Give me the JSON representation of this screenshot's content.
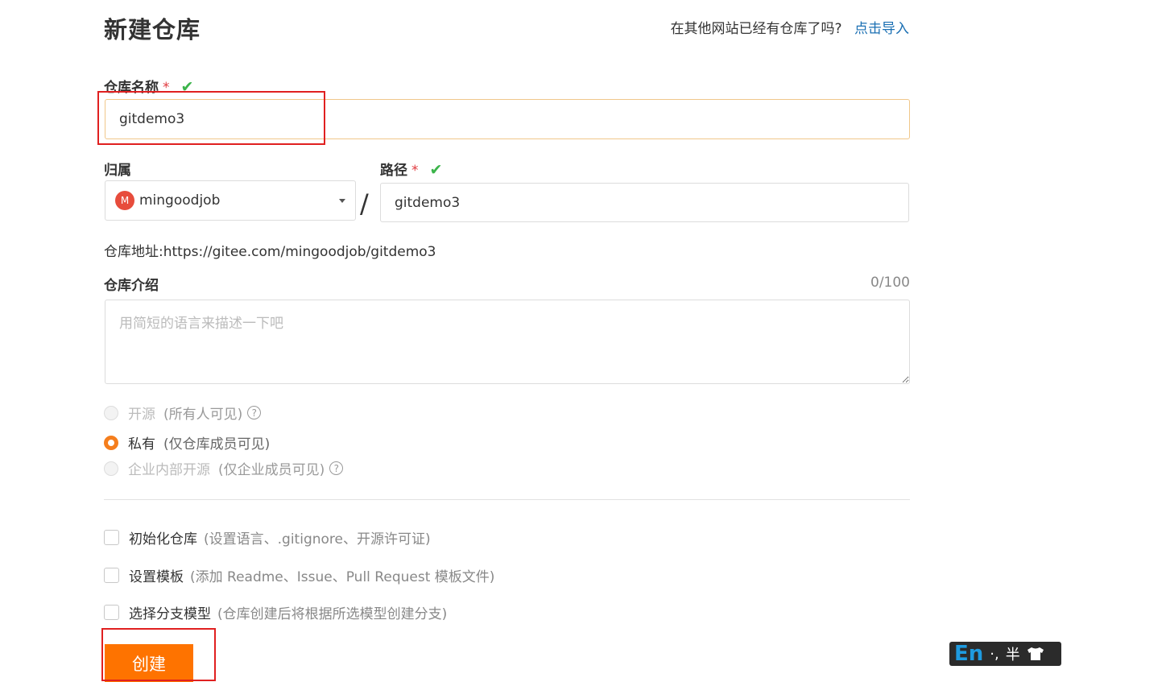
{
  "page": {
    "title": "新建仓库",
    "import_prompt": "在其他网站已经有仓库了吗?",
    "import_link": "点击导入"
  },
  "form": {
    "repo_name_label": "仓库名称",
    "required_mark": "*",
    "repo_name_value": "gitdemo3",
    "owner_label": "归属",
    "owner_avatar": "M",
    "owner_value": "mingoodjob",
    "path_label": "路径",
    "path_separator": "/",
    "path_value": "gitdemo3",
    "repo_url_text": "仓库地址:https://gitee.com/mingoodjob/gitdemo3",
    "intro_label": "仓库介绍",
    "intro_counter": "0/100",
    "intro_placeholder": "用简短的语言来描述一下吧"
  },
  "visibility": {
    "options": [
      {
        "label": "开源",
        "hint": "(所有人可见)",
        "checked": false,
        "disabled": true
      },
      {
        "label": "私有",
        "hint": "(仅仓库成员可见)",
        "checked": true,
        "disabled": false
      },
      {
        "label": "企业内部开源",
        "hint": "(仅企业成员可见)",
        "checked": false,
        "disabled": true
      }
    ]
  },
  "options": [
    {
      "label": "初始化仓库",
      "hint": "(设置语言、.gitignore、开源许可证)"
    },
    {
      "label": "设置模板",
      "hint": "(添加 Readme、Issue、Pull Request 模板文件)"
    },
    {
      "label": "选择分支模型",
      "hint": "(仓库创建后将根据所选模型创建分支)"
    }
  ],
  "actions": {
    "create_label": "创建"
  },
  "ime": {
    "mode": "En",
    "punct": "·,",
    "width": "半"
  },
  "colors": {
    "accent": "#fe7300",
    "link": "#1a6fb3",
    "required": "#e0393e",
    "valid": "#3bb44a",
    "annotation": "#e02020"
  }
}
